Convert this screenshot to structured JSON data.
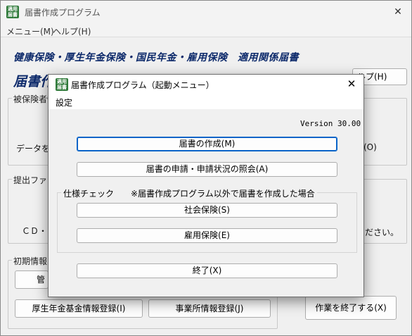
{
  "main_window": {
    "title": "届書作成プログラム",
    "close_glyph": "✕",
    "menu": [
      "メニュー(M)",
      "ヘルプ(H)"
    ],
    "heading": "健康保険・厚生年金保険・国民年金・雇用保険　適用関係届書",
    "app_name_partial": "届書作",
    "icon_text": "適用届書",
    "help_button": "ルプ(H)",
    "groups": {
      "insured": {
        "legend": "被保険者情",
        "text": "データを",
        "button_right": "(O)"
      },
      "submission": {
        "legend": "提出ファイ",
        "text": "ＣＤ・",
        "text_right": "ださい。"
      },
      "initial": {
        "legend": "初期情報",
        "button_partial": "管"
      }
    },
    "bottom_buttons": {
      "pension_fund": "厚生年金基金情報登録(I)",
      "office": "事業所情報登録(J)",
      "exit_work": "作業を終了する(X)"
    }
  },
  "dialog": {
    "title": "届書作成プログラム（起動メニュー）",
    "close_glyph": "✕",
    "menu_settings": "設定",
    "version": "Version 30.00",
    "buttons": {
      "create": "届書の作成(M)",
      "inquiry": "届書の申請・申請状況の照会(A)",
      "social_insurance": "社会保険(S)",
      "employment_insurance": "雇用保険(E)",
      "exit": "終了(X)"
    },
    "spec_check": {
      "legend": "仕様チェック　　※届書作成プログラム以外で届書を作成した場合"
    }
  }
}
